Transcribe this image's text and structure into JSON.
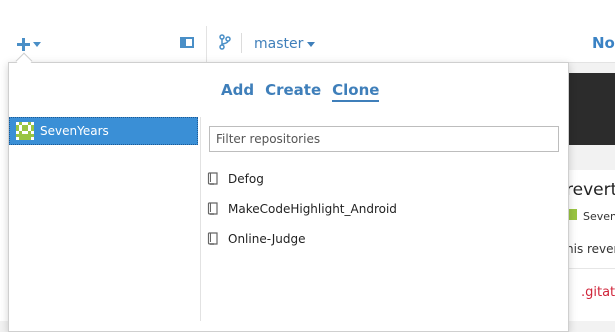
{
  "toolbar": {
    "add_icon": "plus-icon",
    "sidebar_icon": "sidebar-toggle-icon",
    "branch_icon": "branch-icon",
    "branch_label": "master",
    "right_label": "No"
  },
  "background": {
    "commit_title": "revert '",
    "author": "Seven",
    "message": "his rever",
    "file": ".gitat"
  },
  "popover": {
    "tabs": [
      {
        "label": "Add",
        "active": false
      },
      {
        "label": "Create",
        "active": false
      },
      {
        "label": "Clone",
        "active": true
      }
    ],
    "account": {
      "name": "SevenYears",
      "selected": true
    },
    "filter": {
      "placeholder": "Filter repositories",
      "value": ""
    },
    "repositories": [
      {
        "name": "Defog",
        "icon": "repo-icon"
      },
      {
        "name": "MakeCodeHighlight_Android",
        "icon": "repo-icon"
      },
      {
        "name": "Online-Judge",
        "icon": "repo-icon"
      }
    ]
  },
  "colors": {
    "accent": "#3f7fba",
    "selection": "#3a8fd6",
    "avatar_green": "#9ac542",
    "file_red": "#d0263b"
  }
}
